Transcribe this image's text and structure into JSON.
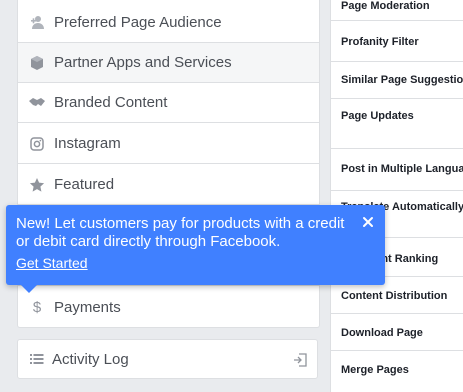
{
  "settings_menu": {
    "items": [
      {
        "label": "Preferred Page Audience",
        "icon": "audience-icon"
      },
      {
        "label": "Partner Apps and Services",
        "icon": "cube-icon"
      },
      {
        "label": "Branded Content",
        "icon": "handshake-icon"
      },
      {
        "label": "Instagram",
        "icon": "instagram-icon"
      },
      {
        "label": "Featured",
        "icon": "star-icon"
      },
      {
        "label": "Payments",
        "icon": "dollar-icon"
      }
    ]
  },
  "activity_log": {
    "label": "Activity Log",
    "icon": "list-icon",
    "action_icon": "enter-icon"
  },
  "general_settings": {
    "rows": [
      "Page Moderation",
      "Profanity Filter",
      "Similar Page Suggestions",
      "Page Updates",
      "Post in Multiple Languages",
      "Translate Automatically",
      "Comment Ranking",
      "Content Distribution",
      "Download Page",
      "Merge Pages"
    ]
  },
  "tooltip": {
    "message": "New! Let customers pay for products with a credit or debit card directly through Facebook.",
    "cta": "Get Started",
    "close_icon": "close-icon",
    "color": "#4080ff"
  }
}
